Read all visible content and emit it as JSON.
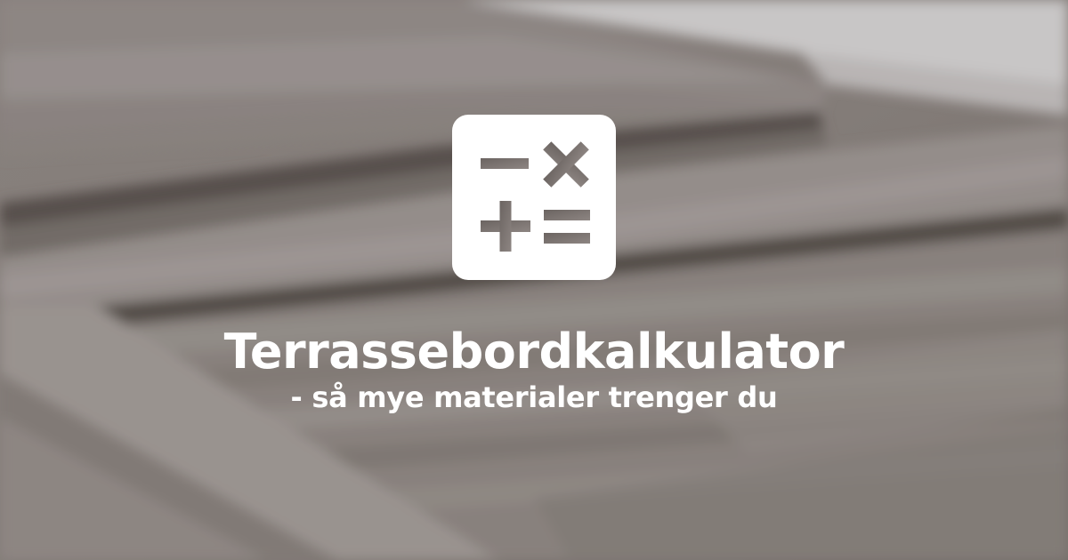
{
  "hero": {
    "title": "Terrassebordkalkulator",
    "subtitle": "- så mye materialer trenger du",
    "icon": "calculator-icon",
    "background": "blurred-wooden-deck-boards"
  },
  "colors": {
    "wood_light": "#a49d9a",
    "wood_mid": "#8b8480",
    "wood_dark": "#5f5753",
    "sky": "#d8d6d6",
    "text": "#ffffff",
    "icon_bg": "#ffffff"
  }
}
